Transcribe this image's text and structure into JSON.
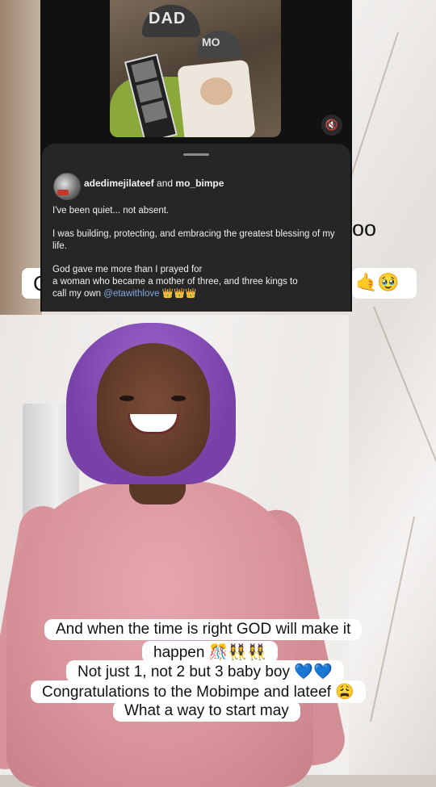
{
  "overlay_post": {
    "photo": {
      "cap1_text": "DAD",
      "cap2_text": "MO"
    },
    "author_primary": "adedimejilateef",
    "author_conjunction": "and",
    "author_secondary": "mo_bimpe",
    "paragraphs": [
      "I've been quiet... not absent.",
      "I was building, protecting, and embracing the greatest blessing of my life."
    ],
    "closing_line_1": "God gave me more than I prayed for",
    "closing_line_2": "a woman who became a mother of three, and three kings to",
    "closing_line_3_prefix": "call my own",
    "mention": "@etawithlove",
    "closing_emojis": "👑👑👑"
  },
  "background_caption": {
    "partial_left": "C",
    "partial_oo": "oo",
    "partial_right_emojis": "🤙🥹"
  },
  "captions": {
    "line1": "And when the time is right GOD will make it",
    "line2": "happen 🎊👯‍♀️👯‍♀️",
    "line3": "Not just 1, not 2 but 3 baby boy 💙💙",
    "line4": "Congratulations to the Mobimpe and lateef 😩",
    "line5": "What a way to start may"
  },
  "icons": [
    "mute-icon",
    "avatar"
  ]
}
